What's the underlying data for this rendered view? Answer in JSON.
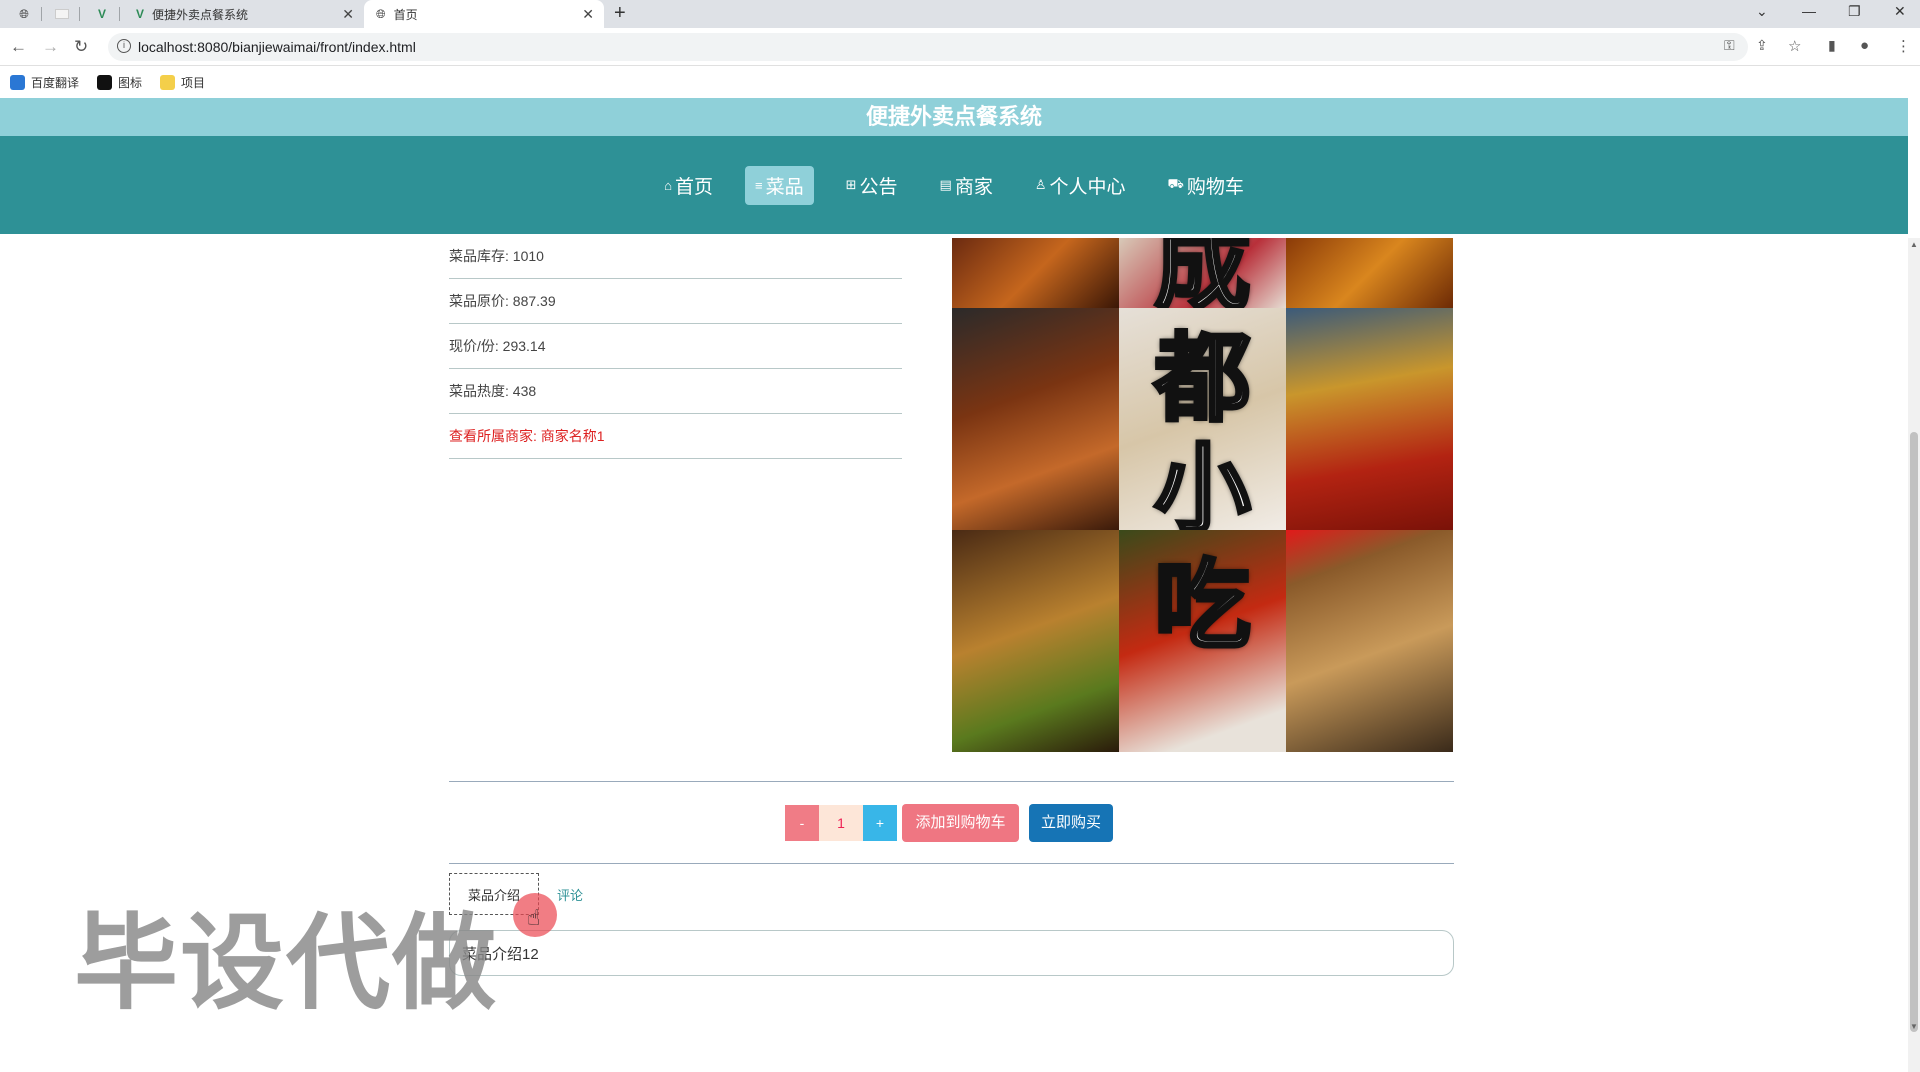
{
  "browser": {
    "tabs": [
      {
        "title": "便捷外卖点餐系统"
      },
      {
        "title": "首页"
      }
    ],
    "url": "localhost:8080/bianjiewaimai/front/index.html",
    "bookmarks": [
      "百度翻译",
      "图标",
      "项目"
    ]
  },
  "site": {
    "title": "便捷外卖点餐系统",
    "nav": [
      "首页",
      "菜品",
      "公告",
      "商家",
      "个人中心",
      "购物车"
    ],
    "nav_icons": [
      "home-icon",
      "list-icon",
      "grid-icon",
      "store-icon",
      "user-icon",
      "cart-icon"
    ]
  },
  "product": {
    "stock": "菜品库存: 1010",
    "original_price": "菜品原价: 887.39",
    "current_price": "现价/份: 293.14",
    "popularity": "菜品热度: 438",
    "merchant_link": "查看所属商家: 商家名称1",
    "image_text": [
      "成",
      "都",
      "小",
      "吃"
    ]
  },
  "purchase": {
    "minus": "-",
    "quantity": "1",
    "plus": "+",
    "add_to_cart": "添加到购物车",
    "buy_now": "立即购买"
  },
  "detail_tabs": {
    "intro": "菜品介绍",
    "comments": "评论",
    "intro_content": "菜品介绍12"
  },
  "watermark": "毕设代做",
  "colors": {
    "site_bar": "#8fd0d9",
    "nav_bar": "#2e9196",
    "buy_button": "#1674b5",
    "cart_button": "#ef7682",
    "link": "#dd2222"
  }
}
